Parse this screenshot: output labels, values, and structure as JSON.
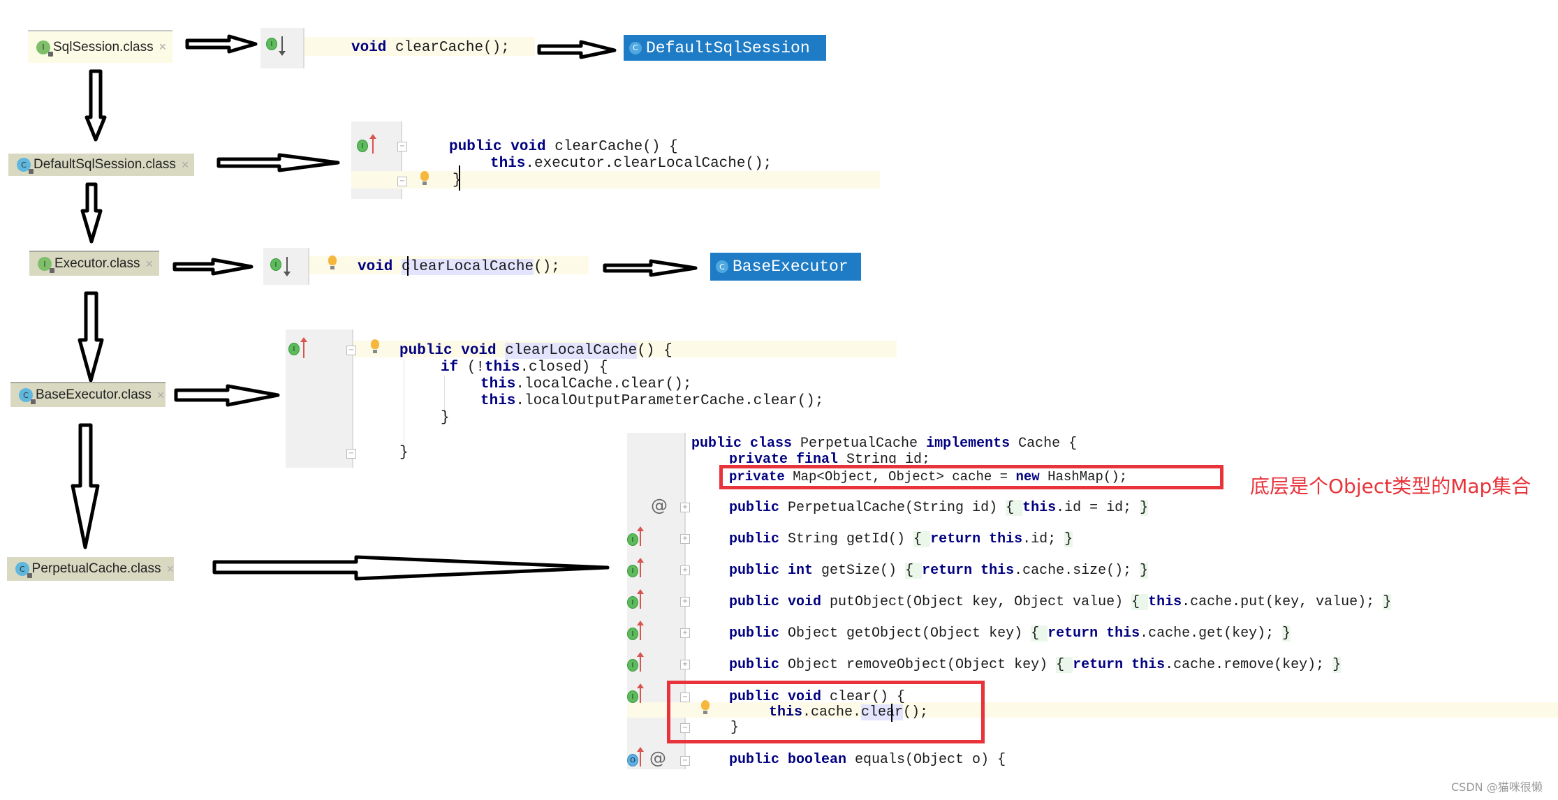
{
  "tabs": [
    {
      "id": "sqlsession",
      "label": "SqlSession.class",
      "icon": "interface-icon",
      "icon_letter": "I"
    },
    {
      "id": "defaultsqlsession",
      "label": "DefaultSqlSession.class",
      "icon": "class-icon",
      "icon_letter": "C"
    },
    {
      "id": "executor",
      "label": "Executor.class",
      "icon": "interface-icon",
      "icon_letter": "I"
    },
    {
      "id": "baseexecutor",
      "label": "BaseExecutor.class",
      "icon": "class-icon",
      "icon_letter": "C"
    },
    {
      "id": "perpetualcache",
      "label": "PerpetualCache.class",
      "icon": "class-icon",
      "icon_letter": "C"
    }
  ],
  "close_glyph": "×",
  "gutter_icons": {
    "interface": "I",
    "override": "O",
    "annotation": "@",
    "fold_minus": "−",
    "fold_plus": "+"
  },
  "snippets": {
    "sqlsession_decl": {
      "kw": "void",
      "rest": " clearCache();"
    },
    "sqlsession_target": {
      "icon_letter": "C",
      "label": "DefaultSqlSession"
    },
    "defaultsqlsession_impl": [
      {
        "kw": "public void",
        "rest": " clearCache() {"
      },
      {
        "kw": "this",
        "rest": ".executor.clearLocalCache();"
      },
      {
        "kw": "",
        "rest": "}"
      }
    ],
    "executor_decl": {
      "kw": "void",
      "name": "clearLocalCache",
      "rest": "();"
    },
    "executor_target": {
      "icon_letter": "C",
      "label": "BaseExecutor"
    },
    "baseexecutor_impl": [
      {
        "kw": "public void",
        "name": "clearLocalCache",
        "rest": "() {"
      },
      {
        "kw": "if",
        "pre": "",
        "mid": " (!",
        "kw2": "this",
        "rest": ".closed) {"
      },
      {
        "kw": "this",
        "rest": ".localCache.clear();"
      },
      {
        "kw": "this",
        "rest": ".localOutputParameterCache.clear();"
      },
      {
        "kw": "",
        "rest": "}"
      },
      {
        "kw": "",
        "rest": "}"
      }
    ],
    "perpetualcache": {
      "class_decl": {
        "kw1": "public class",
        "name": " PerpetualCache ",
        "kw2": "implements",
        "rest": " Cache {"
      },
      "field_id": {
        "kw": "private final",
        "rest": " String id;"
      },
      "field_cache": {
        "kw1": "private",
        "mid": " Map<Object, Object> cache = ",
        "kw2": "new",
        "rest": " HashMap();"
      },
      "methods": [
        {
          "kw": "public",
          "sig": " PerpetualCache(String id) ",
          "body_pre": "{ ",
          "body_kw": "this",
          "body_rest": ".id = id; ",
          "close": "}"
        },
        {
          "kw": "public",
          "sig": " String getId() ",
          "body_pre": "{ ",
          "body_kw": "return this",
          "body_rest": ".id; ",
          "close": "}"
        },
        {
          "kw": "public int",
          "sig": " getSize() ",
          "body_pre": "{ ",
          "body_kw": "return this",
          "body_rest": ".cache.size(); ",
          "close": "}"
        },
        {
          "kw": "public void",
          "sig": " putObject(Object key, Object value) ",
          "body_pre": "{ ",
          "body_kw": "this",
          "body_rest": ".cache.put(key, value); ",
          "close": "}"
        },
        {
          "kw": "public",
          "sig": " Object getObject(Object key) ",
          "body_pre": "{ ",
          "body_kw": "return this",
          "body_rest": ".cache.get(key); ",
          "close": "}"
        },
        {
          "kw": "public",
          "sig": " Object removeObject(Object key) ",
          "body_pre": "{ ",
          "body_kw": "return this",
          "body_rest": ".cache.remove(key); ",
          "close": "}"
        }
      ],
      "clear_method": [
        {
          "kw": "public void",
          "rest": " clear() {"
        },
        {
          "kw": "this",
          "rest": ".cache.",
          "hl": "clear",
          "tail": "();"
        },
        {
          "kw": "",
          "rest": "}"
        }
      ],
      "equals_line": {
        "kw": "public boolean",
        "rest": " equals(Object o) {"
      }
    }
  },
  "annotation": "底层是个Object类型的Map集合",
  "watermark": "CSDN @猫咪很懒",
  "colors": {
    "highlight_red": "#e8333a",
    "target_blue": "#1e7bc6",
    "keyword": "#000080"
  }
}
